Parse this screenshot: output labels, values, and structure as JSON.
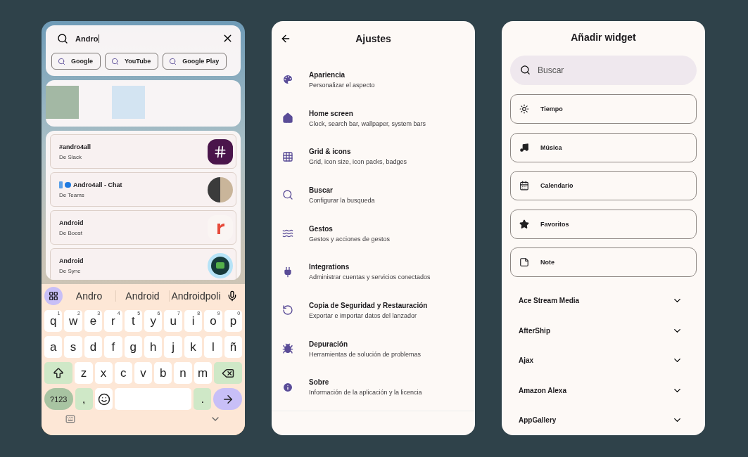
{
  "search_screen": {
    "query": "Andro",
    "chips": [
      {
        "label": "Google"
      },
      {
        "label": "YouTube"
      },
      {
        "label": "Google Play"
      }
    ],
    "app_tiles": [
      {
        "color": "#a3b8a4"
      },
      {
        "color": "#d3e4f2"
      }
    ],
    "results": [
      {
        "title": "#andro4all",
        "subtitle": "De Slack",
        "kind": "slack"
      },
      {
        "title": "Andro4all - Chat",
        "subtitle": "De Teams",
        "kind": "teams"
      },
      {
        "title": "Android",
        "subtitle": "De Boost",
        "kind": "boost"
      },
      {
        "title": "Android",
        "subtitle": "De Sync",
        "kind": "sync"
      }
    ],
    "keyboard": {
      "suggestions": [
        "Andro",
        "Android",
        "Androidpoli"
      ],
      "rows": [
        [
          {
            "kind": "letter",
            "label": "q",
            "hint": "1"
          },
          {
            "kind": "letter",
            "label": "w",
            "hint": "2"
          },
          {
            "kind": "letter",
            "label": "e",
            "hint": "3"
          },
          {
            "kind": "letter",
            "label": "r",
            "hint": "4"
          },
          {
            "kind": "letter",
            "label": "t",
            "hint": "5"
          },
          {
            "kind": "letter",
            "label": "y",
            "hint": "6"
          },
          {
            "kind": "letter",
            "label": "u",
            "hint": "7"
          },
          {
            "kind": "letter",
            "label": "i",
            "hint": "8"
          },
          {
            "kind": "letter",
            "label": "o",
            "hint": "9"
          },
          {
            "kind": "letter",
            "label": "p",
            "hint": "0"
          }
        ],
        [
          {
            "kind": "letter",
            "label": "a"
          },
          {
            "kind": "letter",
            "label": "s"
          },
          {
            "kind": "letter",
            "label": "d"
          },
          {
            "kind": "letter",
            "label": "f"
          },
          {
            "kind": "letter",
            "label": "g"
          },
          {
            "kind": "letter",
            "label": "h"
          },
          {
            "kind": "letter",
            "label": "j"
          },
          {
            "kind": "letter",
            "label": "k"
          },
          {
            "kind": "letter",
            "label": "l"
          },
          {
            "kind": "letter",
            "label": "ñ"
          }
        ],
        [
          {
            "kind": "shift"
          },
          {
            "kind": "letter",
            "label": "z"
          },
          {
            "kind": "letter",
            "label": "x"
          },
          {
            "kind": "letter",
            "label": "c"
          },
          {
            "kind": "letter",
            "label": "v"
          },
          {
            "kind": "letter",
            "label": "b"
          },
          {
            "kind": "letter",
            "label": "n"
          },
          {
            "kind": "letter",
            "label": "m"
          },
          {
            "kind": "backspace"
          }
        ],
        [
          {
            "kind": "symbols",
            "label": "?123"
          },
          {
            "kind": "punct",
            "label": ","
          },
          {
            "kind": "emoji"
          },
          {
            "kind": "space"
          },
          {
            "kind": "punct",
            "label": "."
          },
          {
            "kind": "enter"
          }
        ]
      ]
    }
  },
  "settings_screen": {
    "title": "Ajustes",
    "items": [
      {
        "title": "Apariencia",
        "subtitle": "Personalizar el aspecto"
      },
      {
        "title": "Home screen",
        "subtitle": "Clock, search bar, wallpaper, system bars"
      },
      {
        "title": "Grid & icons",
        "subtitle": "Grid, icon size, icon packs, badges"
      },
      {
        "title": "Buscar",
        "subtitle": "Configurar la busqueda"
      },
      {
        "title": "Gestos",
        "subtitle": "Gestos y acciones de gestos"
      },
      {
        "title": "Integrations",
        "subtitle": "Administrar cuentas y servicios conectados"
      },
      {
        "title": "Copia de Seguridad y Restauración",
        "subtitle": "Exportar e importar datos del lanzador"
      },
      {
        "title": "Depuración",
        "subtitle": "Herramientas de solución de problemas"
      },
      {
        "title": "Sobre",
        "subtitle": "Información de la aplicación y la licencia"
      }
    ]
  },
  "widget_screen": {
    "title": "Añadir widget",
    "search": {
      "placeholder": "Buscar"
    },
    "widgets": [
      {
        "label": "Tiempo"
      },
      {
        "label": "Música"
      },
      {
        "label": "Calendario"
      },
      {
        "label": "Favoritos"
      },
      {
        "label": "Note"
      }
    ],
    "apps": [
      {
        "label": "Ace Stream Media",
        "expanded": false
      },
      {
        "label": "AfterShip",
        "expanded": false
      },
      {
        "label": "Ajax",
        "expanded": false
      },
      {
        "label": "Amazon Alexa",
        "expanded": false
      },
      {
        "label": "AppGallery",
        "expanded": false
      }
    ]
  }
}
